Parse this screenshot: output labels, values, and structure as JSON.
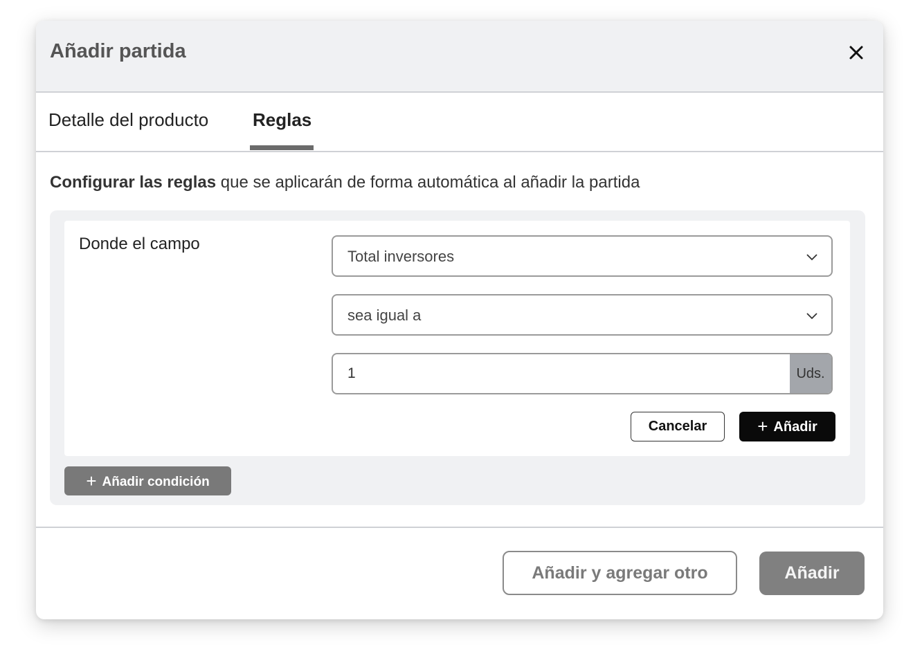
{
  "modal": {
    "title": "Añadir partida",
    "close_icon": "close-icon"
  },
  "tabs": [
    {
      "label": "Detalle del producto",
      "active": false
    },
    {
      "label": "Reglas",
      "active": true
    }
  ],
  "description": {
    "bold": "Configurar las reglas",
    "rest": " que se aplicarán de forma automática al añadir la partida"
  },
  "rule": {
    "field_label": "Donde el campo",
    "field_select": {
      "value": "Total inversores",
      "icon": "chevron-down-icon"
    },
    "operator_select": {
      "value": "sea igual a",
      "icon": "chevron-down-icon"
    },
    "value_input": {
      "value": "1",
      "unit": "Uds."
    },
    "cancel_label": "Cancelar",
    "add_label": "Añadir",
    "add_icon": "plus-icon"
  },
  "add_condition": {
    "label": "Añadir condición",
    "icon": "plus-icon"
  },
  "footer": {
    "add_another_label": "Añadir y agregar otro",
    "add_label": "Añadir"
  },
  "colors": {
    "header_bg": "#f0f1f3",
    "panel_bg": "#f0f1f3",
    "primary_dark": "#0a0a0a",
    "disabled_gray": "#808080",
    "unit_bg": "#a3a6ab"
  }
}
